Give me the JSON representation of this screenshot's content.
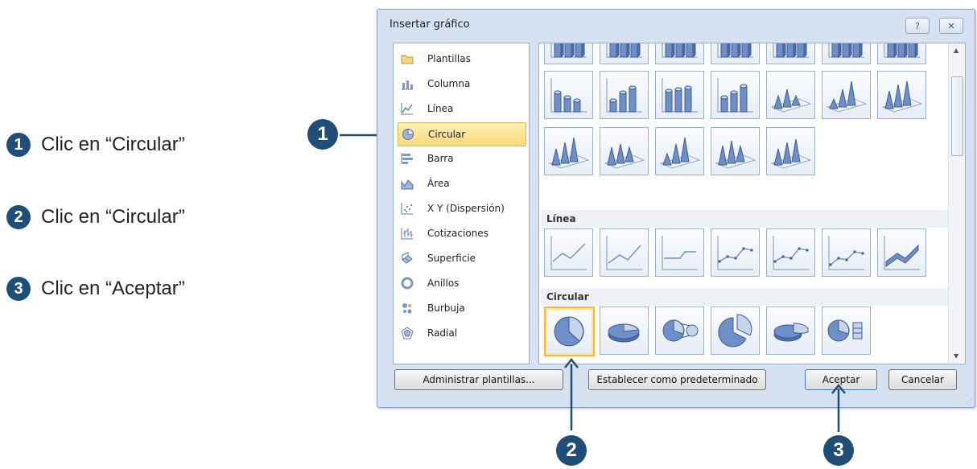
{
  "steps": [
    {
      "number": "1",
      "text": "Clic en “Circular”"
    },
    {
      "number": "2",
      "text": "Clic en “Circular”"
    },
    {
      "number": "3",
      "text": "Clic en “Aceptar”"
    }
  ],
  "callouts": [
    "1",
    "2",
    "3"
  ],
  "dialog": {
    "title": "Insertar gráfico",
    "help_icon": "?",
    "close_icon": "✕",
    "categories": [
      {
        "label": "Plantillas",
        "icon": "folder-icon"
      },
      {
        "label": "Columna",
        "icon": "column-chart-icon"
      },
      {
        "label": "Línea",
        "icon": "line-chart-icon"
      },
      {
        "label": "Circular",
        "icon": "pie-chart-icon",
        "selected": true
      },
      {
        "label": "Barra",
        "icon": "bar-chart-icon"
      },
      {
        "label": "Área",
        "icon": "area-chart-icon"
      },
      {
        "label": "X Y (Dispersión)",
        "icon": "scatter-chart-icon"
      },
      {
        "label": "Cotizaciones",
        "icon": "stock-chart-icon"
      },
      {
        "label": "Superficie",
        "icon": "surface-chart-icon"
      },
      {
        "label": "Anillos",
        "icon": "doughnut-chart-icon"
      },
      {
        "label": "Burbuja",
        "icon": "bubble-chart-icon"
      },
      {
        "label": "Radial",
        "icon": "radar-chart-icon"
      }
    ],
    "sections": {
      "line_header": "Línea",
      "pie_header": "Circular"
    },
    "buttons": {
      "manage_templates": "Administrar plantillas...",
      "set_default": "Establecer como predeterminado",
      "accept": "Aceptar",
      "cancel": "Cancelar"
    }
  },
  "colors": {
    "accent": "#1f4e79",
    "selection": "#fbd978",
    "chart_blue": "#6e8fc7"
  }
}
